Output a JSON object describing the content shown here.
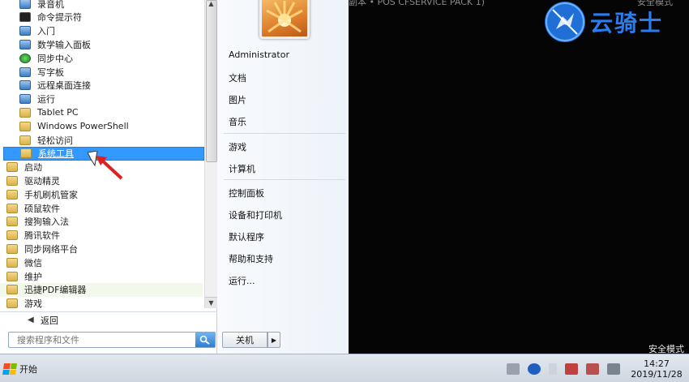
{
  "background": {
    "top_text": "副本 • POS CFSERVICE PACK 1)",
    "top_right_text": "安全模式",
    "safe_mode_label": "安全模式"
  },
  "watermark": {
    "text": "云骑士"
  },
  "programs": [
    {
      "label": "录音机",
      "icon": "microphone-icon"
    },
    {
      "label": "命令提示符",
      "icon": "terminal-icon"
    },
    {
      "label": "入门",
      "icon": "getting-started-icon"
    },
    {
      "label": "数学输入面板",
      "icon": "math-input-icon"
    },
    {
      "label": "同步中心",
      "icon": "sync-icon"
    },
    {
      "label": "写字板",
      "icon": "wordpad-icon"
    },
    {
      "label": "远程桌面连接",
      "icon": "remote-desktop-icon"
    },
    {
      "label": "运行",
      "icon": "run-icon"
    },
    {
      "label": "Tablet PC",
      "icon": "folder-icon"
    },
    {
      "label": "Windows PowerShell",
      "icon": "folder-icon"
    },
    {
      "label": "轻松访问",
      "icon": "folder-icon"
    },
    {
      "label": "系统工具",
      "icon": "folder-icon",
      "selected": true
    },
    {
      "label": "启动",
      "icon": "folder-icon"
    },
    {
      "label": "驱动精灵",
      "icon": "folder-icon"
    },
    {
      "label": "手机刷机管家",
      "icon": "folder-icon"
    },
    {
      "label": "硕鼠软件",
      "icon": "folder-icon"
    },
    {
      "label": "搜狗输入法",
      "icon": "folder-icon"
    },
    {
      "label": "腾讯软件",
      "icon": "folder-icon"
    },
    {
      "label": "同步网络平台",
      "icon": "folder-icon"
    },
    {
      "label": "微信",
      "icon": "folder-icon"
    },
    {
      "label": "维护",
      "icon": "folder-icon"
    },
    {
      "label": "迅捷PDF编辑器",
      "icon": "folder-icon"
    },
    {
      "label": "游戏",
      "icon": "folder-icon"
    }
  ],
  "back_label": "返回",
  "search": {
    "placeholder": "搜索程序和文件"
  },
  "right_pane": {
    "user": "Administrator",
    "items": [
      "文档",
      "图片",
      "音乐",
      "游戏",
      "计算机",
      "控制面板",
      "设备和打印机",
      "默认程序",
      "帮助和支持",
      "运行..."
    ]
  },
  "shutdown_label": "关机",
  "taskbar": {
    "start_label": "开始",
    "time": "14:27",
    "date": "2019/11/28"
  },
  "colors": {
    "selection": "#3399ff",
    "desktop": "#050505",
    "watermark": "#2a7df0",
    "arrow": "#e02020"
  }
}
